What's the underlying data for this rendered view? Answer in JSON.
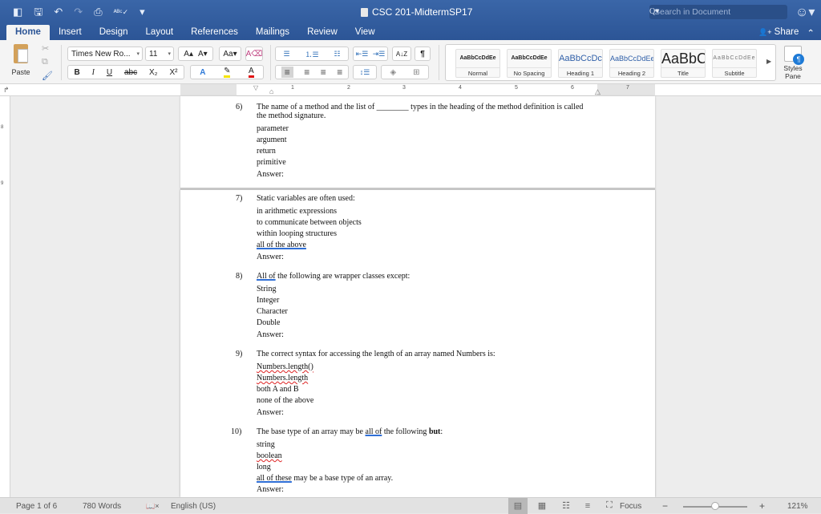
{
  "titlebar": {
    "qat_icons": [
      "sidebar-toggle-icon",
      "save-icon",
      "undo-icon",
      "redo-icon",
      "print-icon",
      "spelling-check-icon",
      "customize-toolbar-icon"
    ],
    "qat_glyphs": [
      "◧",
      "🖫",
      "↶",
      "↷",
      "⎙",
      "ᴬᴮᶜ✓",
      "▾"
    ],
    "document_title": "CSC 201-MidtermSP17",
    "search_placeholder": "Search in Document",
    "search_glyph": "Q▾",
    "feedback_glyph": "☺▾"
  },
  "tabs": [
    {
      "label": "Home",
      "active": true
    },
    {
      "label": "Insert"
    },
    {
      "label": "Design"
    },
    {
      "label": "Layout"
    },
    {
      "label": "References"
    },
    {
      "label": "Mailings"
    },
    {
      "label": "Review"
    },
    {
      "label": "View"
    }
  ],
  "share": {
    "label": "Share",
    "icon_glyph": "👤+",
    "collapse_glyph": "⌃"
  },
  "ribbon": {
    "paste_label": "Paste",
    "cut_glyph": "✂",
    "copy_glyph": "⧉",
    "format_painter_glyph": "🖌",
    "font_name": "Times New Ro...",
    "font_size": "11",
    "grow_font": "A▴",
    "shrink_font": "A▾",
    "change_case": "Aa▾",
    "clear_format": "A⌫",
    "bold": "B",
    "italic": "I",
    "underline": "U",
    "strikethrough": "abc",
    "subscript": "X₂",
    "superscript": "X²",
    "text_effects": "A",
    "highlight": "✎",
    "font_color": "A",
    "highlight_color": "#f5e400",
    "font_color_value": "#e01010",
    "bullets": "☰",
    "numbering": "⒈☰",
    "multilevel": "☷",
    "decrease_indent": "⇤☰",
    "increase_indent": "⇥☰",
    "sort": "A↓Z",
    "show_marks": "¶",
    "align_left": "≡",
    "align_center": "≡",
    "align_right": "≡",
    "justify": "≡",
    "line_spacing": "↕☰",
    "shading": "◈",
    "borders": "⊞",
    "styles": [
      {
        "sample": "AaBbCcDdEe",
        "name": "Normal"
      },
      {
        "sample": "AaBbCcDdEe",
        "name": "No Spacing"
      },
      {
        "sample": "AaBbCcDc",
        "name": "Heading 1"
      },
      {
        "sample": "AaBbCcDdEe",
        "name": "Heading 2"
      },
      {
        "sample": "AaBbC",
        "name": "Title"
      },
      {
        "sample": "AaBbCcDdEe",
        "name": "Subtitle"
      }
    ],
    "gallery_more_glyph": "▶",
    "styles_pane_label": "Styles Pane"
  },
  "ruler": {
    "corner_glyph": "↱",
    "numbers": [
      "1",
      "2",
      "3",
      "4",
      "5",
      "6",
      "7"
    ],
    "vertical_numbers": [
      "8",
      "9"
    ]
  },
  "document": {
    "questions": [
      {
        "number": "6)",
        "text": "The name of a method and the list of ________ types in the heading of the method definition is called the method signature.",
        "options": [
          "parameter",
          "argument",
          "return",
          "primitive"
        ],
        "answer_label": "Answer:"
      },
      {
        "number": "7)",
        "text": "Static variables are often used:",
        "options": [
          "in arithmetic expressions",
          "to communicate between objects",
          "within looping structures",
          "all of the above"
        ],
        "answer_label": "Answer:"
      },
      {
        "number": "8)",
        "text_underlined": "All of",
        "text_rest": " the following are wrapper classes except:",
        "options": [
          "String",
          "Integer",
          "Character",
          "Double"
        ],
        "answer_label": "Answer:"
      },
      {
        "number": "9)",
        "text": "The correct syntax for accessing the length of an array named Numbers is:",
        "options": [
          "Numbers.length()",
          "Numbers.length",
          "both A and B",
          "none of the above"
        ],
        "answer_label": "Answer:"
      },
      {
        "number": "10)",
        "text_pre": "The base type of an array may be ",
        "text_underlined": "all of",
        "text_mid": " the following ",
        "text_bold": "but",
        "text_post": ":",
        "options": [
          "string",
          "boolean",
          "long",
          "all of these may be a base type of an array."
        ],
        "answer_label": "Answer:"
      }
    ]
  },
  "statusbar": {
    "page": "Page 1 of 6",
    "words": "780 Words",
    "proofing_glyph": "📖×",
    "language": "English (US)",
    "views": [
      "print-layout-icon",
      "web-layout-icon",
      "outline-icon",
      "draft-icon"
    ],
    "view_glyphs": [
      "▤",
      "▦",
      "☷",
      "≡"
    ],
    "focus_label": "Focus",
    "zoom_out": "−",
    "zoom_in": "+",
    "zoom_level": "121%",
    "zoom_percent": 121
  }
}
